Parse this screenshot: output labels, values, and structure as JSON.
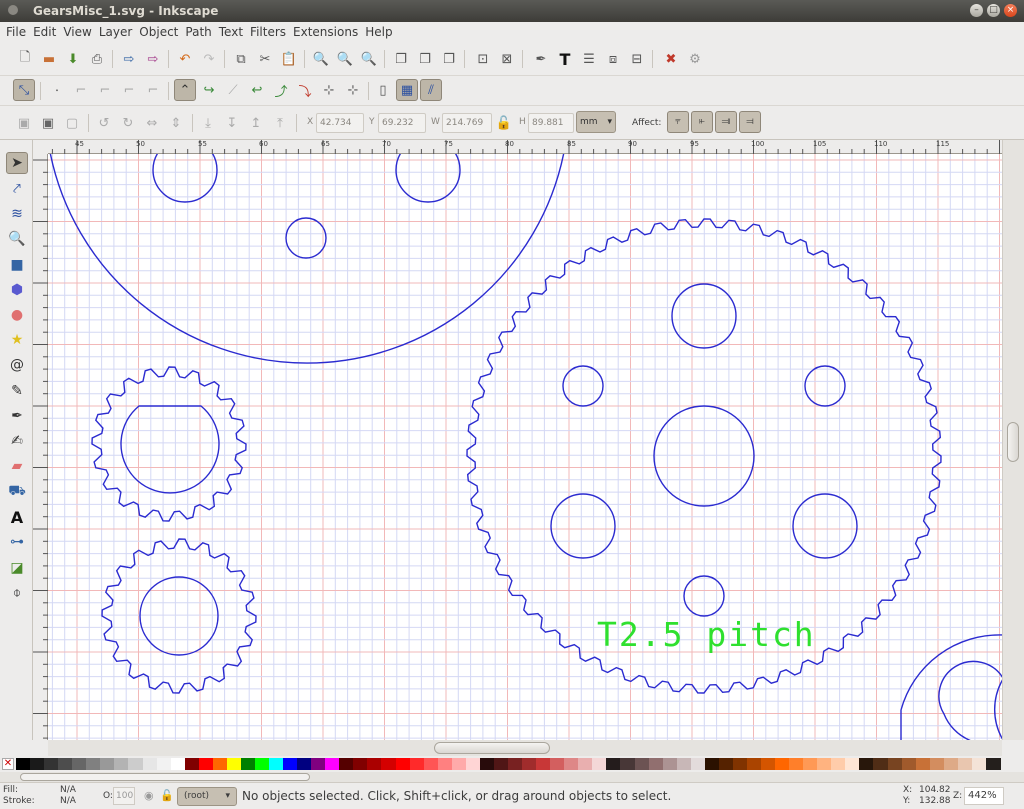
{
  "window": {
    "title": "GearsMisc_1.svg - Inkscape"
  },
  "menu": [
    "File",
    "Edit",
    "View",
    "Layer",
    "Object",
    "Path",
    "Text",
    "Filters",
    "Extensions",
    "Help"
  ],
  "toolbar3": {
    "x_label": "X",
    "x_value": "42.734",
    "y_label": "Y",
    "y_value": "69.232",
    "w_label": "W",
    "w_value": "214.769",
    "h_label": "H",
    "h_value": "89.881",
    "units": "mm",
    "affect_label": "Affect:"
  },
  "ruler": {
    "ticks": [
      "45",
      "50",
      "55",
      "60",
      "65",
      "70",
      "75",
      "80",
      "85",
      "90",
      "95",
      "100",
      "105",
      "110",
      "115"
    ]
  },
  "canvas": {
    "annotation_text": "T2.5 pitch",
    "stroke_color": "#2b2bd0",
    "text_color": "#2fe02f"
  },
  "status": {
    "fill_label": "Fill:",
    "fill_value": "N/A",
    "stroke_label": "Stroke:",
    "stroke_value": "N/A",
    "opacity_label": "O:",
    "opacity_value": "100",
    "layer": "(root)",
    "message": "No objects selected. Click, Shift+click, or drag around objects to select.",
    "x_label": "X:",
    "x_value": "104.82",
    "y_label": "Y:",
    "y_value": "132.88",
    "zoom_label": "Z:",
    "zoom_value": "442%"
  },
  "palette_colors": [
    "#000000",
    "#1a1a1a",
    "#333333",
    "#4d4d4d",
    "#666666",
    "#808080",
    "#999999",
    "#b3b3b3",
    "#cccccc",
    "#e6e6e6",
    "#f2f2f2",
    "#ffffff",
    "#800000",
    "#ff0000",
    "#ff6600",
    "#ffff00",
    "#008000",
    "#00ff00",
    "#00ffff",
    "#0000ff",
    "#000080",
    "#800080",
    "#ff00ff",
    "#550000",
    "#800000",
    "#aa0000",
    "#d40000",
    "#ff0000",
    "#ff2a2a",
    "#ff5555",
    "#ff8080",
    "#ffaaaa",
    "#ffd5d5",
    "#280b0b",
    "#501616",
    "#782121",
    "#a02c2c",
    "#c83737",
    "#d35f5f",
    "#de8787",
    "#e9afaf",
    "#f4d7d7",
    "#241c1c",
    "#483737",
    "#6c5353",
    "#916f6f",
    "#ac9393",
    "#c8b7b7",
    "#e3dbdb",
    "#2b1100",
    "#552200",
    "#803300",
    "#aa4400",
    "#d45500",
    "#ff6600",
    "#ff7f2a",
    "#ff9955",
    "#ffb380",
    "#ffccaa",
    "#ffe6d5",
    "#28170b",
    "#502d16",
    "#784421",
    "#a05a2c",
    "#c87137",
    "#d38d5f",
    "#deaa87",
    "#e9c6af",
    "#f4e3d7",
    "#241f1c"
  ]
}
